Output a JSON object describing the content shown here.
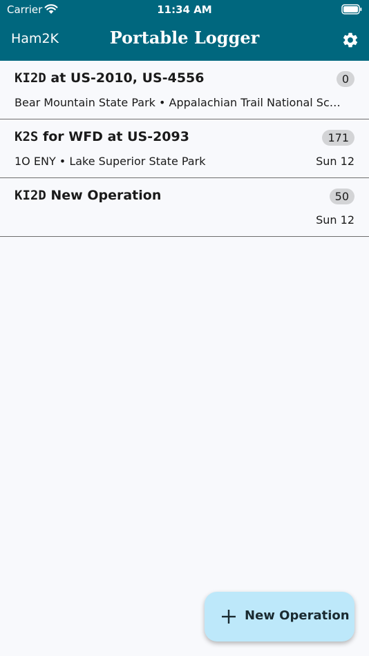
{
  "status_bar": {
    "carrier": "Carrier",
    "time": "11:34 AM",
    "icons": [
      "wifi-icon",
      "battery-icon"
    ]
  },
  "nav": {
    "left_label": "Ham2K",
    "title": "Portable Logger",
    "settings_icon": "gear-icon"
  },
  "operations": [
    {
      "call": "KI2D",
      "title_rest": " at US-2010, US-4556",
      "subtitle": "Bear Mountain State Park • Appalachian Trail National Sce...",
      "count": "0",
      "date": ""
    },
    {
      "call": "K2S",
      "title_rest": " for WFD at US-2093",
      "subtitle": "1O ENY • Lake Superior State Park",
      "count": "171",
      "date": "Sun 12"
    },
    {
      "call": "KI2D",
      "title_rest": " New Operation",
      "subtitle": "",
      "count": "50",
      "date": "Sun 12"
    }
  ],
  "fab": {
    "label": "New Operation",
    "icon": "plus-icon"
  },
  "colors": {
    "header_bg": "#00677e",
    "page_bg": "#f8f9fc",
    "badge_bg": "#d3d4d6",
    "fab_bg": "#bde8fa"
  }
}
